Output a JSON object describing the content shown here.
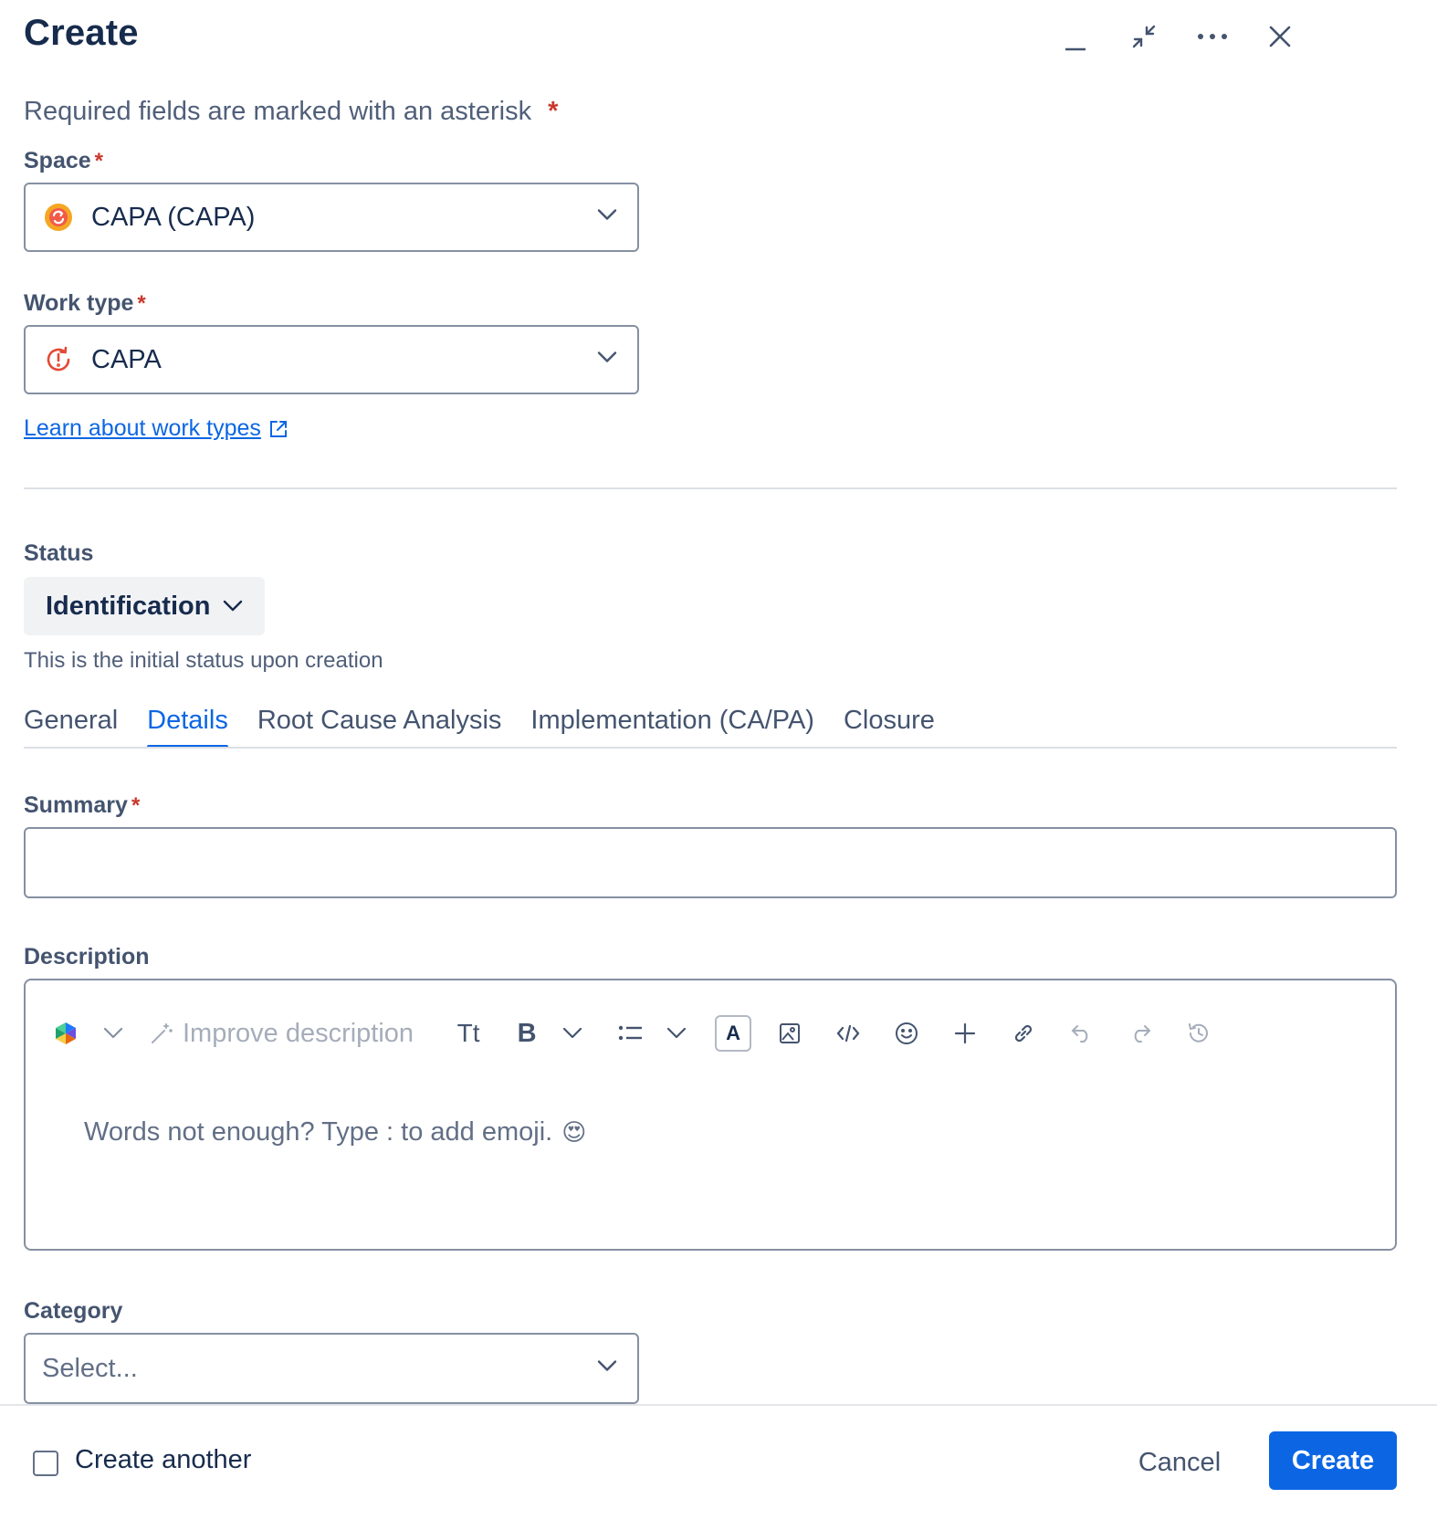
{
  "header": {
    "title": "Create",
    "minimize_icon": "minimize-icon",
    "collapse_icon": "collapse-icon",
    "more_icon": "more-icon",
    "close_icon": "close-icon"
  },
  "required_note": {
    "text": "Required fields are marked with an asterisk",
    "asterisk": "*"
  },
  "space": {
    "label": "Space",
    "required": "*",
    "value": "CAPA (CAPA)",
    "icon": "capa-space-icon"
  },
  "work_type": {
    "label": "Work type",
    "required": "*",
    "value": "CAPA",
    "icon": "capa-alert-icon",
    "learn_link": "Learn about work types"
  },
  "status": {
    "label": "Status",
    "value": "Identification",
    "hint": "This is the initial status upon creation"
  },
  "tabs": [
    {
      "label": "General",
      "active": false
    },
    {
      "label": "Details",
      "active": true
    },
    {
      "label": "Root Cause Analysis",
      "active": false
    },
    {
      "label": "Implementation (CA/PA)",
      "active": false
    },
    {
      "label": "Closure",
      "active": false
    }
  ],
  "summary": {
    "label": "Summary",
    "required": "*",
    "value": ""
  },
  "description": {
    "label": "Description",
    "toolbar": {
      "improve": "Improve description",
      "text_style": "Tt",
      "bold": "B",
      "text_color": "A"
    },
    "placeholder": "Words not enough? Type : to add emoji.",
    "emoji": "😍"
  },
  "category": {
    "label": "Category",
    "placeholder": "Select..."
  },
  "footer": {
    "create_another": "Create another",
    "cancel": "Cancel",
    "create": "Create"
  },
  "colors": {
    "primary": "#0c66e4",
    "required": "#c9372c",
    "border": "#8590a2"
  }
}
